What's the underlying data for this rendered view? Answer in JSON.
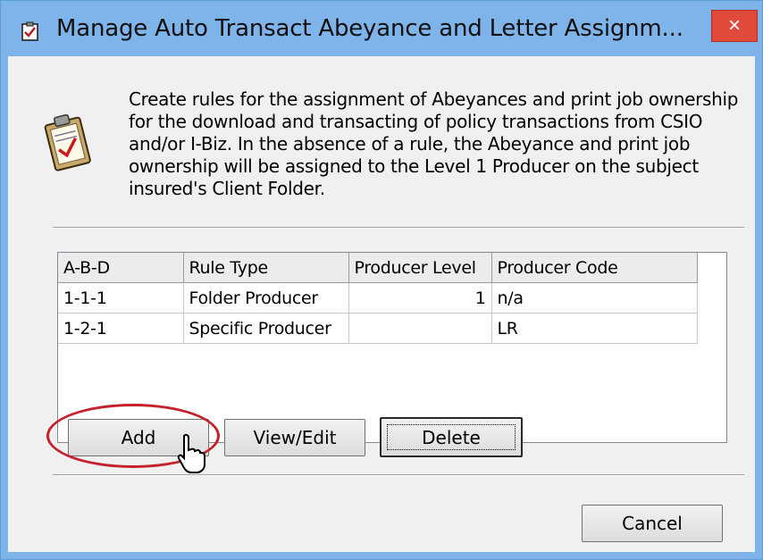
{
  "window": {
    "title": "Manage Auto Transact Abeyance and Letter Assignm...",
    "close_label": "×"
  },
  "description": "Create rules for the assignment of Abeyances and print job ownership for the download and transacting of policy transactions from CSIO and/or I-Biz. In the absence of a rule, the Abeyance and print job ownership will be assigned to the Level 1 Producer on the subject insured's Client Folder.",
  "grid": {
    "columns": [
      "A-B-D",
      "Rule Type",
      "Producer Level",
      "Producer Code"
    ],
    "rows": [
      [
        "1-1-1",
        "Folder Producer",
        "1",
        "n/a"
      ],
      [
        "1-2-1",
        "Specific Producer",
        "",
        "LR"
      ]
    ]
  },
  "buttons": {
    "add": "Add",
    "view_edit": "View/Edit",
    "delete": "Delete",
    "cancel": "Cancel"
  },
  "colors": {
    "titlebar": "#7eb4ea",
    "close": "#e04a3b",
    "highlight": "#c8202b"
  },
  "icons": [
    "checklist-icon",
    "clipboard-icon",
    "close-icon",
    "mouse-pointer-icon"
  ]
}
